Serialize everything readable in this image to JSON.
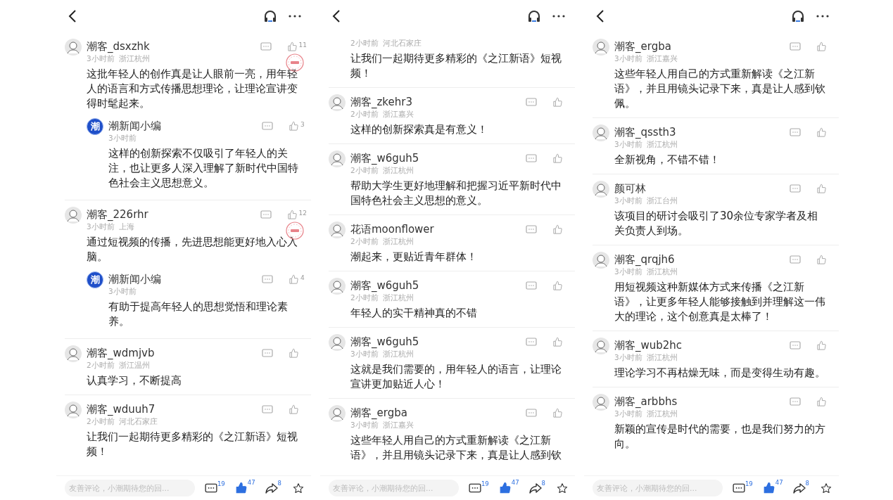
{
  "panels": [
    {
      "comments": [
        {
          "user": "潮客_dsxzhk",
          "time": "3小时前",
          "location": "浙江杭州",
          "likes": "11",
          "hot": true,
          "text": "这批年轻人的创作真是让人眼前一亮，用年轻人的语言和方式传播思想理论，让理论宣讲变得时髦起来。",
          "replies": [
            {
              "user": "潮新闻小编",
              "logo_text": "潮",
              "time": "3小时前",
              "likes": "3",
              "text": "这样的创新探索不仅吸引了年轻人的关注，也让更多人深入理解了新时代中国特色社会主义思想意义。"
            }
          ]
        },
        {
          "user": "潮客_226rhr",
          "time": "3小时前",
          "location": "上海",
          "likes": "12",
          "hot": true,
          "text": "通过短视频的传播，先进思想能更好地入心入脑。",
          "replies": [
            {
              "user": "潮新闻小编",
              "logo_text": "潮",
              "time": "3小时前",
              "likes": "4",
              "text": "有助于提高年轻人的思想觉悟和理论素养。"
            }
          ]
        },
        {
          "user": "潮客_wdmjvb",
          "time": "2小时前",
          "location": "浙江温州",
          "text": "认真学习，不断提高"
        },
        {
          "user": "潮客_wduuh7",
          "time": "2小时前",
          "location": "河北石家庄",
          "text": "让我们一起期待更多精彩的《之江新语》短视频！"
        }
      ],
      "footer": {
        "placeholder": "友善评论，小潮期待您的回...",
        "comments": "19",
        "likes": "47",
        "liked": true,
        "shares": "8"
      }
    },
    {
      "comments": [
        {
          "time": "2小时前",
          "location": "河北石家庄",
          "text": "让我们一起期待更多精彩的《之江新语》短视频！"
        },
        {
          "user": "潮客_zkehr3",
          "time": "2小时前",
          "location": "浙江嘉兴",
          "text": "这样的创新探索真是有意义！"
        },
        {
          "user": "潮客_w6guh5",
          "time": "2小时前",
          "location": "浙江杭州",
          "text": "帮助大学生更好地理解和把握习近平新时代中国特色社会主义思想的意义。"
        },
        {
          "user": "花语moonflower",
          "time": "2小时前",
          "location": "浙江杭州",
          "text": "潮起来，更贴近青年群体！"
        },
        {
          "user": "潮客_w6guh5",
          "time": "2小时前",
          "location": "浙江杭州",
          "text": "年轻人的实干精神真的不错"
        },
        {
          "user": "潮客_w6guh5",
          "time": "3小时前",
          "location": "浙江杭州",
          "text": "这就是我们需要的，用年轻人的语言，让理论宣讲更加贴近人心！"
        },
        {
          "user": "潮客_ergba",
          "time": "3小时前",
          "location": "浙江嘉兴",
          "text": "这些年轻人用自己的方式重新解读《之江新语》，并且用镜头记录下来，真是让人感到钦"
        }
      ],
      "footer": {
        "placeholder": "友善评论，小潮期待您的回...",
        "comments": "19",
        "likes": "47",
        "liked": true,
        "shares": "8"
      }
    },
    {
      "comments": [
        {
          "user": "潮客_ergba",
          "time": "3小时前",
          "location": "浙江嘉兴",
          "text": "这些年轻人用自己的方式重新解读《之江新语》，并且用镜头记录下来，真是让人感到钦佩。"
        },
        {
          "user": "潮客_qssth3",
          "time": "3小时前",
          "location": "浙江杭州",
          "text": "全新视角，不错不错！"
        },
        {
          "user": "颜可林",
          "time": "3小时前",
          "location": "浙江台州",
          "text": "该项目的研讨会吸引了30余位专家学者及相关负责人到场。"
        },
        {
          "user": "潮客_qrqjh6",
          "time": "3小时前",
          "location": "浙江杭州",
          "text": "用短视频这种新媒体方式来传播《之江新语》，让更多年轻人能够接触到并理解这一伟大的理论，这个创意真是太棒了！"
        },
        {
          "user": "潮客_wub2hc",
          "time": "3小时前",
          "location": "浙江杭州",
          "text": "理论学习不再枯燥无味，而是变得生动有趣。"
        },
        {
          "user": "潮客_arbbhs",
          "time": "3小时前",
          "location": "浙江杭州",
          "text": "新颖的宣传是时代的需要，也是我们努力的方向。"
        }
      ],
      "footer": {
        "placeholder": "友善评论，小潮期待您的回...",
        "comments": "19",
        "likes": "47",
        "liked": true,
        "shares": "8"
      }
    }
  ]
}
